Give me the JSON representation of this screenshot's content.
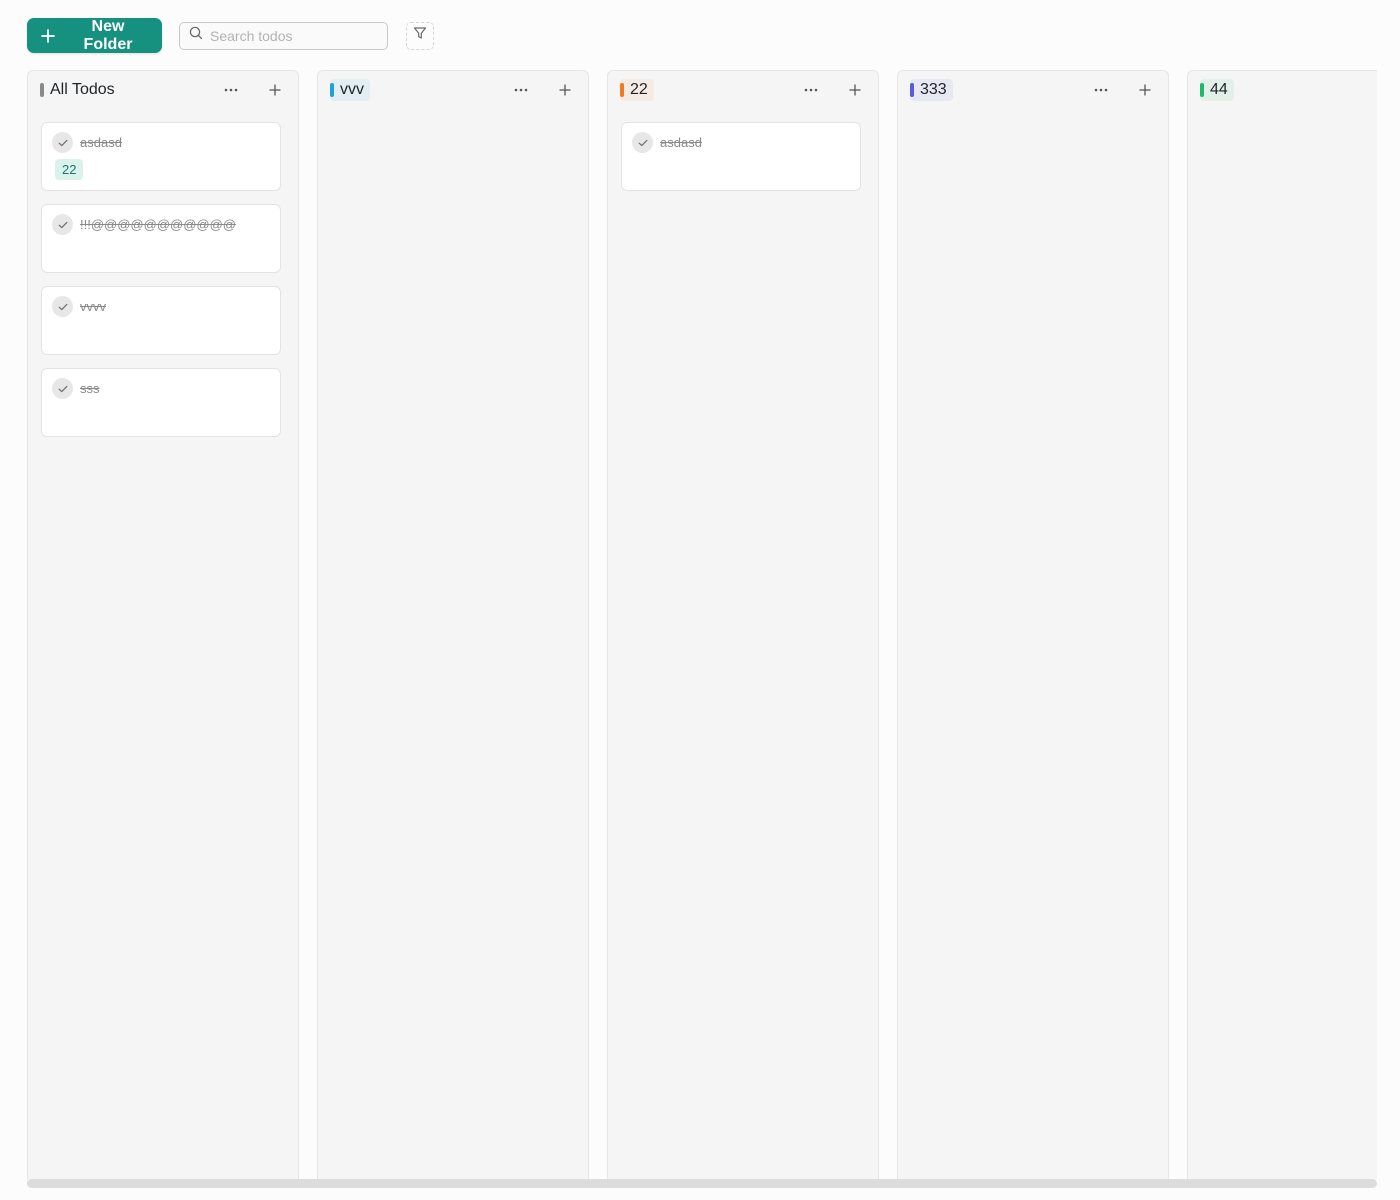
{
  "toolbar": {
    "new_folder_label": "New Folder",
    "search_placeholder": "Search todos",
    "filter_icon": "filter-icon",
    "search_icon": "search-icon",
    "accent": "#16907f"
  },
  "columns": [
    {
      "name": "All Todos",
      "color": "#8a8a8a",
      "cards": [
        {
          "text": "asdasd",
          "done": true,
          "tag": "22"
        },
        {
          "text": "!!!@@@@@@@@@@@",
          "done": true
        },
        {
          "text": "vvvv",
          "done": true
        },
        {
          "text": "sss",
          "done": true
        }
      ]
    },
    {
      "name": "vvv",
      "color": "#1ea0d9",
      "cards": []
    },
    {
      "name": "22",
      "color": "#ee7a22",
      "cards": [
        {
          "text": "asdasd",
          "done": true
        }
      ]
    },
    {
      "name": "333",
      "color": "#5b5bd9",
      "cards": []
    },
    {
      "name": "44",
      "color": "#1fb86a",
      "cards": []
    }
  ]
}
